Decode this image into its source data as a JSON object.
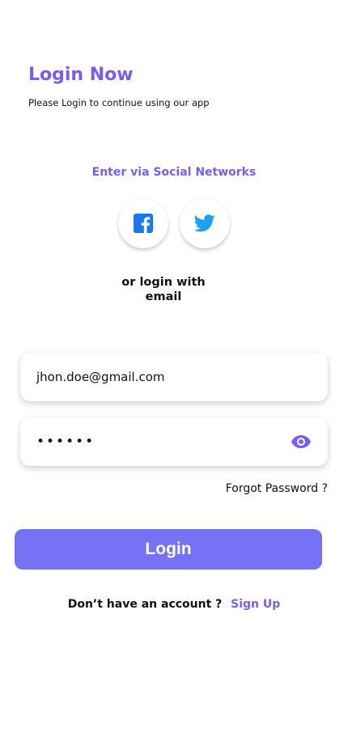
{
  "colors": {
    "accent": "#7a5cf0",
    "button": "#7572f5",
    "facebook": "#1877f2",
    "twitter": "#1da1f2"
  },
  "header": {
    "title": "Login Now",
    "subtitle": "Please Login to continue using our app"
  },
  "social": {
    "heading": "Enter via Social Networks",
    "buttons": [
      {
        "icon": "facebook-icon"
      },
      {
        "icon": "twitter-icon"
      }
    ]
  },
  "divider_text": "or login with email",
  "form": {
    "email_value": "jhon.doe@gmail.com",
    "password_mask": "••••••",
    "password_toggle_icon": "eye-icon",
    "forgot_label": "Forgot Password ?",
    "login_label": "Login"
  },
  "footer": {
    "prompt": "Don’t have an account ?",
    "signup_label": "Sign Up"
  }
}
